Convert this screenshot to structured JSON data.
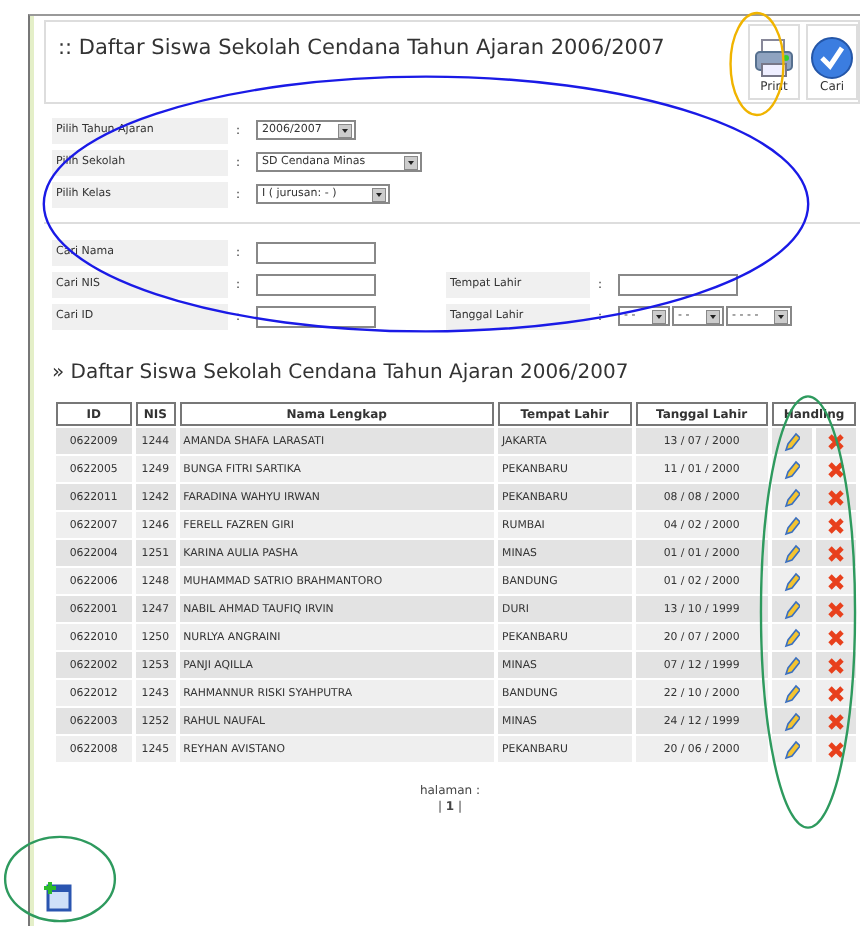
{
  "header": {
    "title": ":: Daftar Siswa Sekolah Cendana Tahun Ajaran 2006/2007",
    "buttons": [
      {
        "kind": "print",
        "label": "Print"
      },
      {
        "kind": "search",
        "label": "Cari"
      }
    ]
  },
  "selects": [
    {
      "label": "Pilih Tahun Ajaran",
      "colon": ":",
      "value": "2006/2007"
    },
    {
      "label": "Pilih Sekolah",
      "colon": ":",
      "value": "SD Cendana Minas"
    },
    {
      "label": "Pilih Kelas",
      "colon": ":",
      "value": "I ( jurusan: - )"
    }
  ],
  "search_fields": [
    {
      "label": "Cari Nama",
      "colon": ":"
    },
    {
      "label": "Cari NIS",
      "colon": ":"
    },
    {
      "label": "Cari ID",
      "colon": ":"
    }
  ],
  "side_fields": [
    {
      "kind": "text",
      "label": "Tempat Lahir",
      "colon": ":"
    },
    {
      "kind": "date",
      "label": "Tanggal Lahir",
      "colon": ":",
      "parts": [
        "- -",
        "- -",
        "- - - -"
      ]
    }
  ],
  "list_title": "» Daftar Siswa Sekolah Cendana Tahun Ajaran 2006/2007",
  "table": {
    "columns": [
      "ID",
      "NIS",
      "Nama Lengkap",
      "Tempat Lahir",
      "Tanggal Lahir",
      "Handling"
    ],
    "rows": [
      [
        "0622009",
        "1244",
        "AMANDA SHAFA LARASATI",
        "JAKARTA",
        "13 / 07 / 2000"
      ],
      [
        "0622005",
        "1249",
        "BUNGA FITRI SARTIKA",
        "PEKANBARU",
        "11 / 01 / 2000"
      ],
      [
        "0622011",
        "1242",
        "FARADINA WAHYU IRWAN",
        "PEKANBARU",
        "08 / 08 / 2000"
      ],
      [
        "0622007",
        "1246",
        "FERELL FAZREN GIRI",
        "RUMBAI",
        "04 / 02 / 2000"
      ],
      [
        "0622004",
        "1251",
        "KARINA AULIA PASHA",
        "MINAS",
        "01 / 01 / 2000"
      ],
      [
        "0622006",
        "1248",
        "MUHAMMAD SATRIO BRAHMANTORO",
        "BANDUNG",
        "01 / 02 / 2000"
      ],
      [
        "0622001",
        "1247",
        "NABIL AHMAD TAUFIQ IRVIN",
        "DURI",
        "13 / 10 / 1999"
      ],
      [
        "0622010",
        "1250",
        "NURLYA ANGRAINI",
        "PEKANBARU",
        "20 / 07 / 2000"
      ],
      [
        "0622002",
        "1253",
        "PANJI AQILLA",
        "MINAS",
        "07 / 12 / 1999"
      ],
      [
        "0622012",
        "1243",
        "RAHMANNUR RISKI SYAHPUTRA",
        "BANDUNG",
        "22 / 10 / 2000"
      ],
      [
        "0622003",
        "1252",
        "RAHUL NAUFAL",
        "MINAS",
        "24 / 12 / 1999"
      ],
      [
        "0622008",
        "1245",
        "REYHAN AVISTANO",
        "PEKANBARU",
        "20 / 06 / 2000"
      ]
    ]
  },
  "pagination": {
    "label": "halaman :",
    "pages": "| **1** |"
  },
  "circles": [
    {
      "color": "#1a1ae6"
    },
    {
      "color": "#f0b400"
    },
    {
      "color": "#2e9a5e"
    },
    {
      "color": "#2e9a5e"
    }
  ]
}
